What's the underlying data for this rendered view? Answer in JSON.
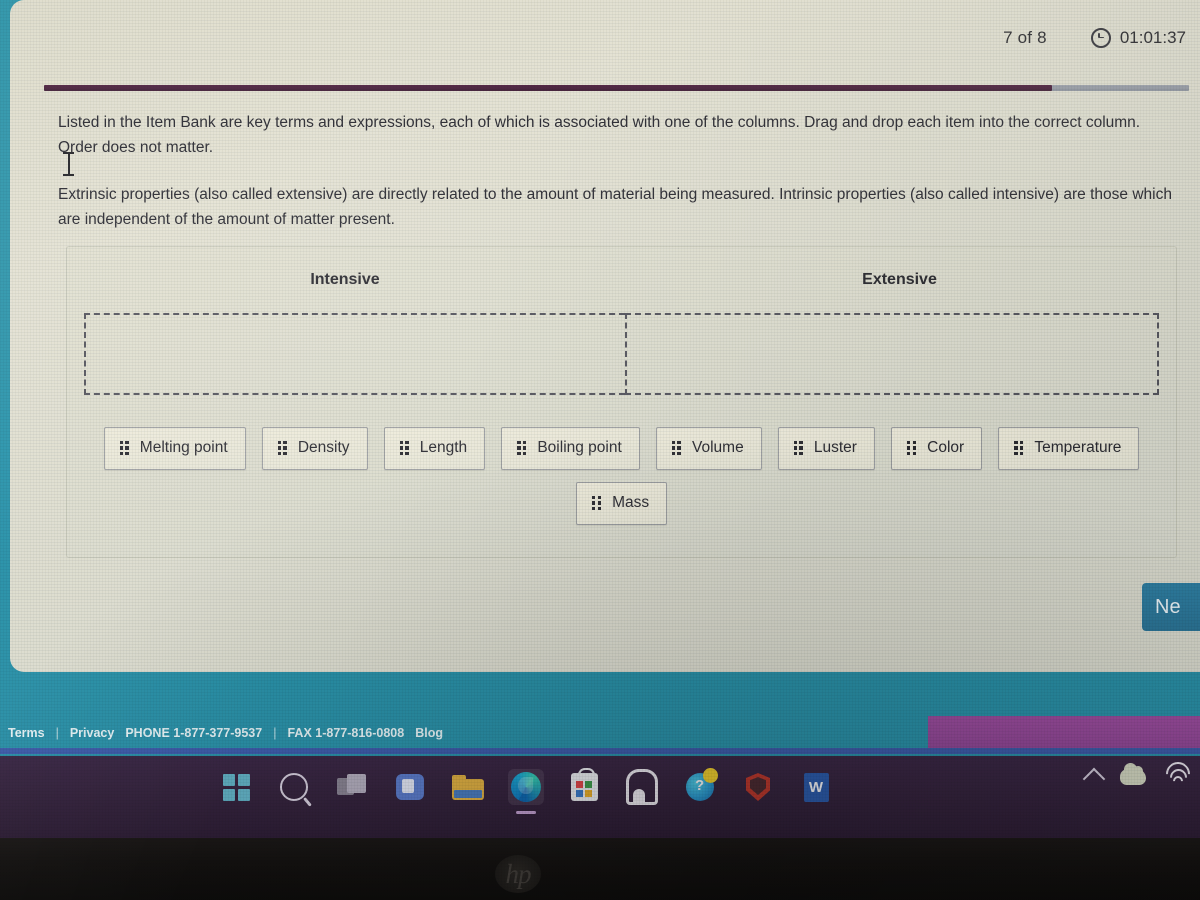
{
  "quiz": {
    "counter": "7 of 8",
    "timer": "01:01:37",
    "clock_icon": "clock-icon",
    "progress_percent": 88,
    "instructions": {
      "paragraph1": "Listed in the Item Bank are key terms and expressions, each of which is associated with one of the columns. Drag and drop each item into the correct column. Order does not matter.",
      "paragraph2": "Extrinsic properties (also called extensive) are directly related to the amount of material being measured. Intrinsic properties (also called intensive) are those which are independent of the amount of matter present."
    },
    "columns": [
      {
        "label": "Intensive",
        "dropzone_items": []
      },
      {
        "label": "Extensive",
        "dropzone_items": []
      }
    ],
    "item_bank": {
      "row1": [
        {
          "label": "Melting point",
          "handle_icon": "drag-handle-icon"
        },
        {
          "label": "Density",
          "handle_icon": "drag-handle-icon"
        },
        {
          "label": "Length",
          "handle_icon": "drag-handle-icon"
        },
        {
          "label": "Boiling point",
          "handle_icon": "drag-handle-icon"
        },
        {
          "label": "Volume",
          "handle_icon": "drag-handle-icon"
        },
        {
          "label": "Luster",
          "handle_icon": "drag-handle-icon"
        },
        {
          "label": "Color",
          "handle_icon": "drag-handle-icon"
        },
        {
          "label": "Temperature",
          "handle_icon": "drag-handle-icon"
        }
      ],
      "row2": [
        {
          "label": "Mass",
          "handle_icon": "drag-handle-icon"
        }
      ]
    },
    "next_button_label": "Ne"
  },
  "site_footer": {
    "terms": "Terms",
    "sep1": "|",
    "privacy": "Privacy",
    "phone": "PHONE 1-877-377-9537",
    "sep2": "|",
    "fax": "FAX 1-877-816-0808",
    "blog": "Blog"
  },
  "taskbar": {
    "icons": [
      {
        "name": "start-icon"
      },
      {
        "name": "search-icon"
      },
      {
        "name": "task-view-icon"
      },
      {
        "name": "chat-icon"
      },
      {
        "name": "file-explorer-icon"
      },
      {
        "name": "edge-icon"
      },
      {
        "name": "microsoft-store-icon"
      },
      {
        "name": "arch-app-icon"
      },
      {
        "name": "globe-help-icon"
      },
      {
        "name": "mcafee-shield-icon"
      },
      {
        "name": "word-icon"
      }
    ],
    "tray": [
      {
        "name": "chevron-up-icon"
      },
      {
        "name": "cloud-icon"
      },
      {
        "name": "wifi-icon"
      }
    ]
  },
  "device": {
    "brand_logo": "hp"
  },
  "colors": {
    "page_teal": "#2a93a8",
    "progress_fill": "#4d1f3f",
    "next_button": "#2f80a4",
    "promo_band": "#9b4c9e",
    "taskbar": "#34233d"
  }
}
